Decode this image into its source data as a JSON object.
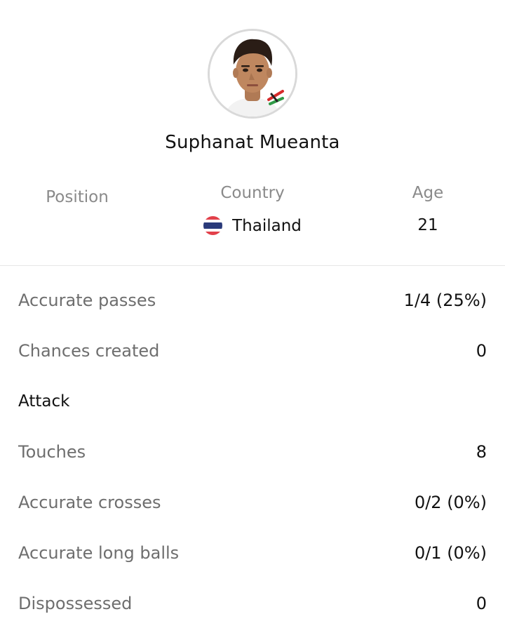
{
  "player": {
    "name": "Suphanat Mueanta",
    "avatar_alt": "player-photo"
  },
  "info": {
    "position_label": "Position",
    "country_label": "Country",
    "country_value": "Thailand",
    "age_label": "Age",
    "age_value": "21"
  },
  "stats": {
    "accurate_passes": {
      "label": "Accurate passes",
      "value": "1/4 (25%)"
    },
    "chances_created": {
      "label": "Chances created",
      "value": "0"
    },
    "attack_header": "Attack",
    "touches": {
      "label": "Touches",
      "value": "8"
    },
    "accurate_crosses": {
      "label": "Accurate crosses",
      "value": "0/2 (0%)"
    },
    "accurate_long_balls": {
      "label": "Accurate long balls",
      "value": "0/1 (0%)"
    },
    "dispossessed": {
      "label": "Dispossessed",
      "value": "0"
    }
  },
  "colors": {
    "label_gray": "#6e6e6e",
    "header_gray": "#8a8a8a",
    "text_dark": "#111111",
    "divider": "#e6e6e6",
    "flag_red": "#e2404a",
    "flag_blue": "#2a3a7a"
  }
}
